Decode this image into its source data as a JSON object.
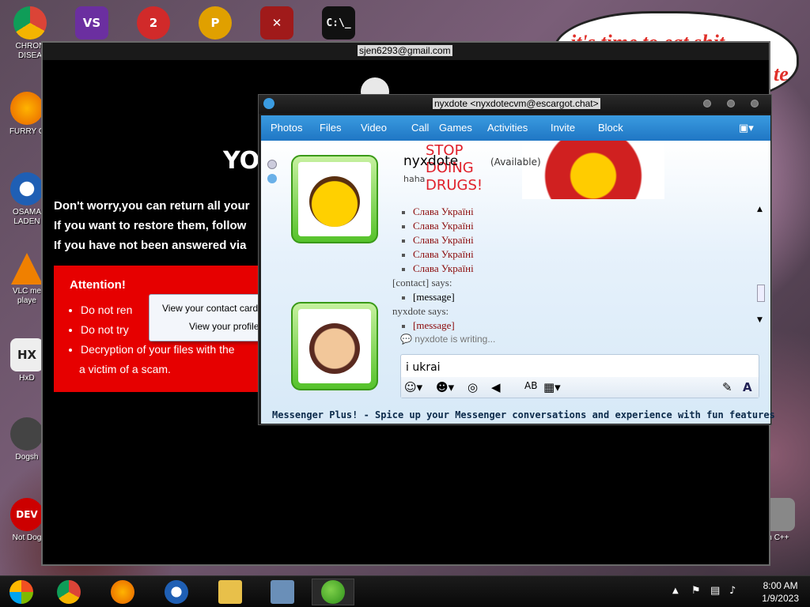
{
  "desktop": {
    "speech_text": "it's time to eat shit",
    "speech_tail": "te",
    "icons": [
      {
        "name": "chrome",
        "label": "CHRON\nDISEA",
        "color": "#2f9e44"
      },
      {
        "name": "visual-studio",
        "label": "",
        "color": "#6b2fa0"
      },
      {
        "name": "game2",
        "label": "",
        "color": "#d12a2a"
      },
      {
        "name": "game-p",
        "label": "",
        "color": "#e0a000"
      },
      {
        "name": "game-x",
        "label": "",
        "color": "#a01a1a"
      },
      {
        "name": "cmd",
        "label": "",
        "color": "#111111"
      },
      {
        "name": "firefox",
        "label": "FURRY C",
        "color": "#e66000"
      },
      {
        "name": "osama",
        "label": "OSAMA\nLADEN",
        "color": "#1f5fb4"
      },
      {
        "name": "vlc",
        "label": "VLC me\nplaye",
        "color": "#f08000"
      },
      {
        "name": "hx",
        "label": "HxD",
        "color": "#eeeeee"
      },
      {
        "name": "dogs",
        "label": "Dogsh",
        "color": "#444444"
      },
      {
        "name": "dev-cpp",
        "label": "Not Dog",
        "color": "#cc0000"
      },
      {
        "name": "recycle",
        "label": "n C++",
        "color": "#888888"
      }
    ]
  },
  "ransom": {
    "title": "sjen6293@gmail.com",
    "heading": "YO",
    "lines": [
      "Don't worry,you can return all your",
      "If you want to restore them, follow",
      "If you have not been answered via"
    ],
    "attention_title": "Attention!",
    "attention_items": [
      "Do not ren",
      "Do not try",
      "Decryption of your files with the",
      "a victim of a scam."
    ]
  },
  "context_menu": {
    "items": [
      "View your contact card",
      "View your profile"
    ]
  },
  "messenger": {
    "title": "nyxdote <nyxdotecvm@escargot.chat>",
    "toolbar": [
      "Photos",
      "Files",
      "Video",
      "Call",
      "Games",
      "Activities",
      "Invite",
      "Block"
    ],
    "contact_name": "nyxdote",
    "contact_status": "(Available)",
    "psm": "haha",
    "banner_text": [
      "STOP",
      "DOING",
      "DRUGS!"
    ],
    "messages": [
      {
        "text": "Слава Україні",
        "style": "red",
        "bullet": true
      },
      {
        "text": "Слава Україні",
        "style": "red",
        "bullet": true
      },
      {
        "text": "Слава Україні",
        "style": "red",
        "bullet": true
      },
      {
        "text": "Слава Україні",
        "style": "red",
        "bullet": true
      },
      {
        "text": "Слава Україні",
        "style": "red",
        "bullet": true
      },
      {
        "text": "[contact] says:",
        "style": "header",
        "bullet": false
      },
      {
        "text": "[message]",
        "style": "plain",
        "bullet": true
      },
      {
        "text": "nyxdote says:",
        "style": "header",
        "bullet": false
      },
      {
        "text": "[message]",
        "style": "red",
        "bullet": true
      }
    ],
    "writing": "nyxdote is writing...",
    "input_value": "i ukrai",
    "footer": "Messenger Plus! - Spice up your Messenger conversations and experience with fun features"
  },
  "taskbar": {
    "time": "8:00 AM",
    "date": "1/9/2023"
  }
}
